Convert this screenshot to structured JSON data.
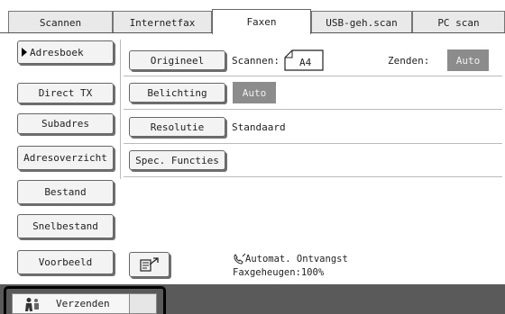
{
  "tabs": [
    {
      "label": "Scannen"
    },
    {
      "label": "Internetfax"
    },
    {
      "label": "Faxen"
    },
    {
      "label": "USB-geh.scan"
    },
    {
      "label": "PC scan"
    }
  ],
  "active_tab": "Faxen",
  "sidebar": {
    "items": [
      {
        "label": "Adresboek"
      },
      {
        "label": "Direct TX"
      },
      {
        "label": "Subadres"
      },
      {
        "label": "Adresoverzicht"
      },
      {
        "label": "Bestand"
      },
      {
        "label": "Snelbestand"
      },
      {
        "label": "Voorbeeld"
      }
    ]
  },
  "settings": {
    "original_button": "Origineel",
    "scan_label": "Scannen:",
    "scan_size": "A4",
    "send_label": "Zenden:",
    "send_value": "Auto",
    "exposure_button": "Belichting",
    "exposure_value": "Auto",
    "resolution_button": "Resolutie",
    "resolution_value": "Standaard",
    "special_button": "Spec. Functies"
  },
  "status": {
    "receive_mode": "Automat. Ontvangst",
    "memory": "Faxgeheugen:100%"
  },
  "bottom": {
    "send_label": "Verzenden"
  },
  "icons": {
    "phone": "phone-icon",
    "dial": "dial-icon",
    "send_person": "person-send-icon"
  },
  "colors": {
    "value_box_bg": "#8c8c8c",
    "bottom_bar": "#5a5a5a"
  }
}
